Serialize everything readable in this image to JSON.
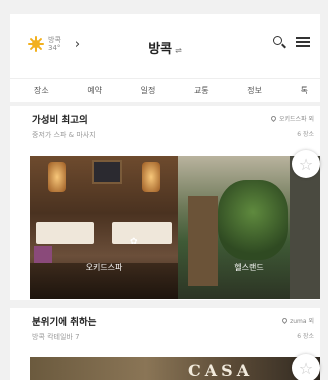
{
  "weather": {
    "city": "방콕",
    "temp": "34°",
    "icon": "sun-icon"
  },
  "header": {
    "title": "방콕",
    "swap_glyph": "⇌"
  },
  "tabs": [
    {
      "label": "장소"
    },
    {
      "label": "예약"
    },
    {
      "label": "일정"
    },
    {
      "label": "교통"
    },
    {
      "label": "정보"
    },
    {
      "label": "톡"
    }
  ],
  "cards": [
    {
      "title": "가성비 최고의",
      "subtitle": "중저가 스파 & 마사지",
      "location": "오키드스파 외",
      "count": "6 장소",
      "photos": [
        {
          "label": "오키드스파"
        },
        {
          "label": "헬스랜드"
        }
      ]
    },
    {
      "title": "분위기에 취하는",
      "subtitle": "방콕 칵테일바 7",
      "location": "zuma 외",
      "count": "6 장소",
      "photo_sign": "CASA"
    }
  ],
  "colors": {
    "accent": "#f2b01e",
    "text": "#222222",
    "muted": "#9a9a9a"
  }
}
